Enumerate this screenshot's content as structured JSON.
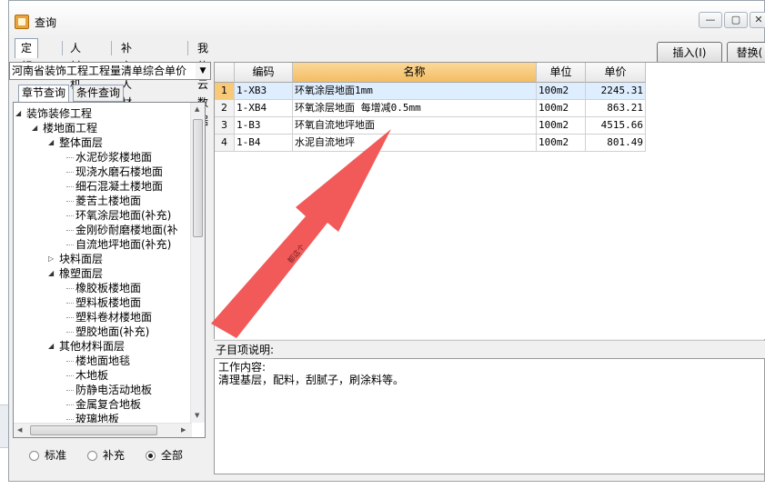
{
  "window": {
    "title": "查询",
    "controls": [
      "—",
      "▢",
      "✕"
    ]
  },
  "tabs": [
    {
      "label": "定额",
      "active": true
    },
    {
      "label": "人材机",
      "active": false
    },
    {
      "label": "补充人材机",
      "active": false
    },
    {
      "label": "我的云数据",
      "active": false
    }
  ],
  "toolbar": {
    "insert_label": "插入(I)",
    "replace_label": "替换("
  },
  "library_select": {
    "value": "河南省装饰工程工程量清单综合单价"
  },
  "subtabs": [
    {
      "label": "章节查询",
      "active": true
    },
    {
      "label": "条件查询",
      "active": false
    }
  ],
  "tree": [
    {
      "label": "装饰装修工程",
      "level": 0,
      "toggle": "expanded"
    },
    {
      "label": "楼地面工程",
      "level": 1,
      "toggle": "expanded"
    },
    {
      "label": "整体面层",
      "level": 2,
      "toggle": "expanded"
    },
    {
      "label": "水泥砂浆楼地面",
      "level": 3,
      "toggle": "none"
    },
    {
      "label": "现浇水磨石楼地面",
      "level": 3,
      "toggle": "none"
    },
    {
      "label": "细石混凝土楼地面",
      "level": 3,
      "toggle": "none"
    },
    {
      "label": "菱苦土楼地面",
      "level": 3,
      "toggle": "none"
    },
    {
      "label": "环氧涂层地面(补充)",
      "level": 3,
      "toggle": "none"
    },
    {
      "label": "金刚砂耐磨楼地面(补",
      "level": 3,
      "toggle": "none"
    },
    {
      "label": "自流地坪地面(补充)",
      "level": 3,
      "toggle": "none"
    },
    {
      "label": "块料面层",
      "level": 2,
      "toggle": "collapsed"
    },
    {
      "label": "橡塑面层",
      "level": 2,
      "toggle": "expanded"
    },
    {
      "label": "橡胶板楼地面",
      "level": 3,
      "toggle": "none"
    },
    {
      "label": "塑料板楼地面",
      "level": 3,
      "toggle": "none"
    },
    {
      "label": "塑料卷材楼地面",
      "level": 3,
      "toggle": "none"
    },
    {
      "label": "塑胶地面(补充)",
      "level": 3,
      "toggle": "none"
    },
    {
      "label": "其他材料面层",
      "level": 2,
      "toggle": "expanded"
    },
    {
      "label": "楼地面地毯",
      "level": 3,
      "toggle": "none"
    },
    {
      "label": "木地板",
      "level": 3,
      "toggle": "none"
    },
    {
      "label": "防静电活动地板",
      "level": 3,
      "toggle": "none"
    },
    {
      "label": "金属复合地板",
      "level": 3,
      "toggle": "none"
    },
    {
      "label": "玻璃地板",
      "level": 3,
      "toggle": "none"
    }
  ],
  "filter_radios": [
    {
      "label": "标准",
      "checked": false
    },
    {
      "label": "补充",
      "checked": false
    },
    {
      "label": "全部",
      "checked": true
    }
  ],
  "table": {
    "columns": [
      "编码",
      "名称",
      "单位",
      "单价"
    ],
    "rows": [
      {
        "num": "1",
        "code": "1-XB3",
        "name": "环氧涂层地面1mm",
        "unit": "100m2",
        "price": "2245.31"
      },
      {
        "num": "2",
        "code": "1-XB4",
        "name": "环氧涂层地面 每增减0.5mm",
        "unit": "100m2",
        "price": "863.21"
      },
      {
        "num": "3",
        "code": "1-B3",
        "name": "环氧自流地坪地面",
        "unit": "100m2",
        "price": "4515.66"
      },
      {
        "num": "4",
        "code": "1-B4",
        "name": "水泥自流地坪",
        "unit": "100m2",
        "price": "801.49"
      }
    ]
  },
  "annotation": {
    "text": "都这个",
    "color": "#f25a5a"
  },
  "description": {
    "label": "子目项说明:",
    "heading": "工作内容:",
    "content": "清理基层，配料，刮腻子，刷涂料等。"
  },
  "colors": {
    "selected_row": "#dfeefe",
    "header_highlight": "#f7c978",
    "accent": "#3399ff"
  }
}
